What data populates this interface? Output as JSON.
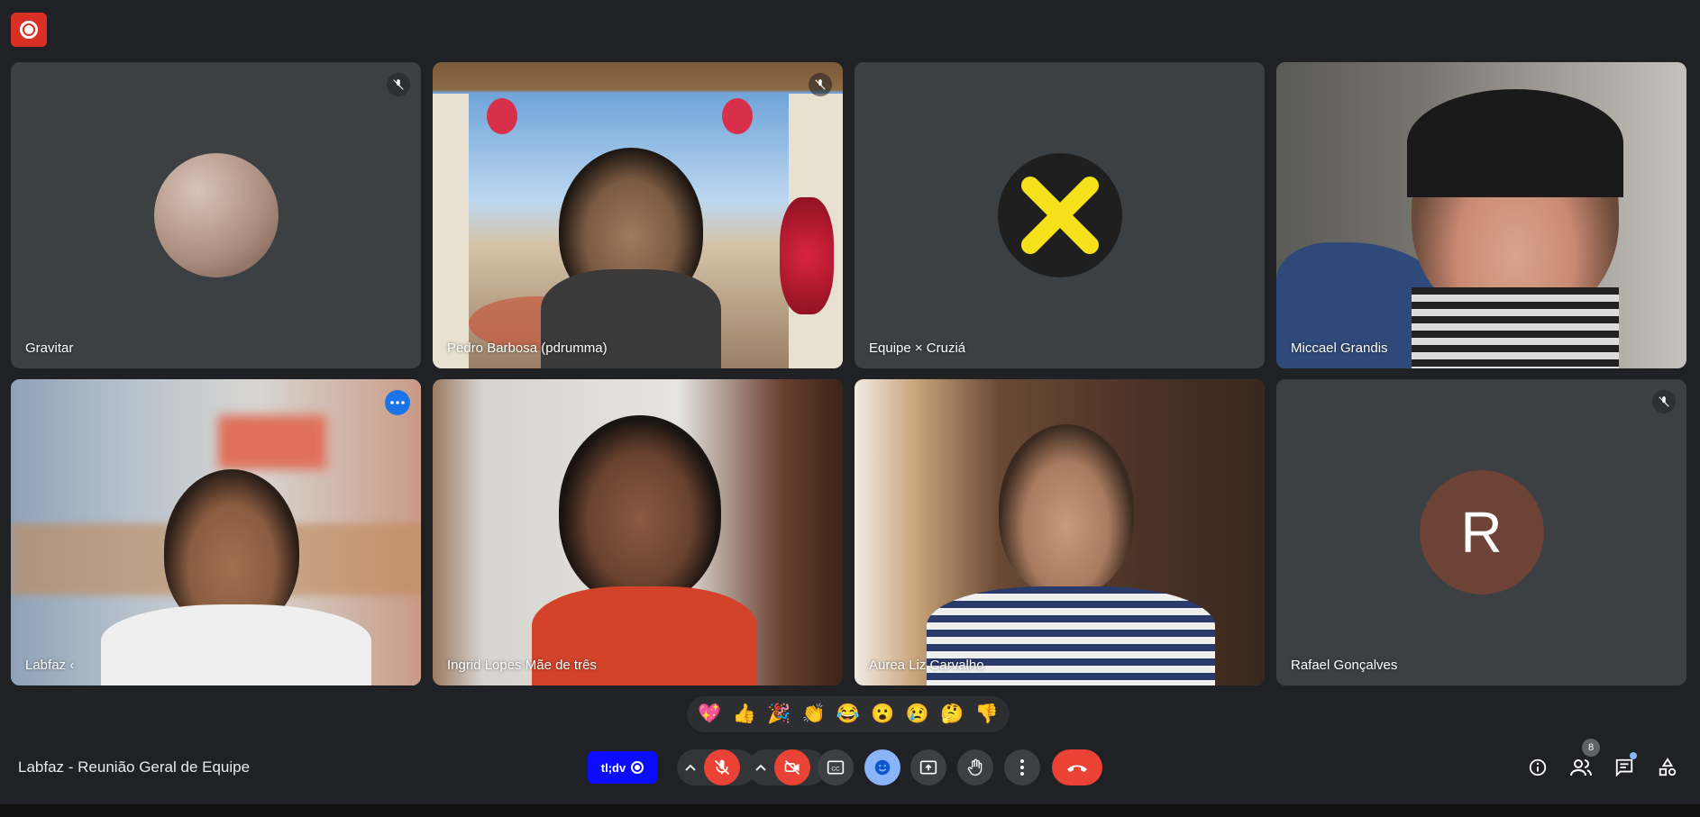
{
  "participants": [
    {
      "name": "Gravitar",
      "muted": true
    },
    {
      "name": "Pedro Barbosa (pdrumma)",
      "muted": true
    },
    {
      "name": "Equipe × Cruziá",
      "muted": false
    },
    {
      "name": "Miccael Grandis",
      "muted": false
    },
    {
      "name": "Labfaz ‹",
      "muted": false,
      "active_speaker": true
    },
    {
      "name": "Ingrid Lopes Mãe de três",
      "muted": false
    },
    {
      "name": "Aurea Liz Carvalho",
      "muted": false
    },
    {
      "name": "Rafael Gonçalves",
      "muted": true,
      "initial": "R"
    }
  ],
  "reactions": [
    "💖",
    "👍",
    "🎉",
    "👏",
    "😂",
    "😮",
    "😢",
    "🤔",
    "👎"
  ],
  "meeting": {
    "title": "Labfaz - Reunião Geral de Equipe"
  },
  "tldv": {
    "label": "tl;dv"
  },
  "people_count": "8",
  "colors": {
    "background": "#202124",
    "tile": "#3c4043",
    "accent": "#8ab4f8",
    "danger": "#ea4335",
    "tldv": "#0b0bff"
  },
  "icons": [
    "record-icon",
    "mic-off-icon",
    "camera-off-icon",
    "captions-icon",
    "emoji-icon",
    "present-icon",
    "raise-hand-icon",
    "more-vert-icon",
    "hangup-icon",
    "info-icon",
    "people-icon",
    "chat-icon",
    "activities-icon"
  ]
}
